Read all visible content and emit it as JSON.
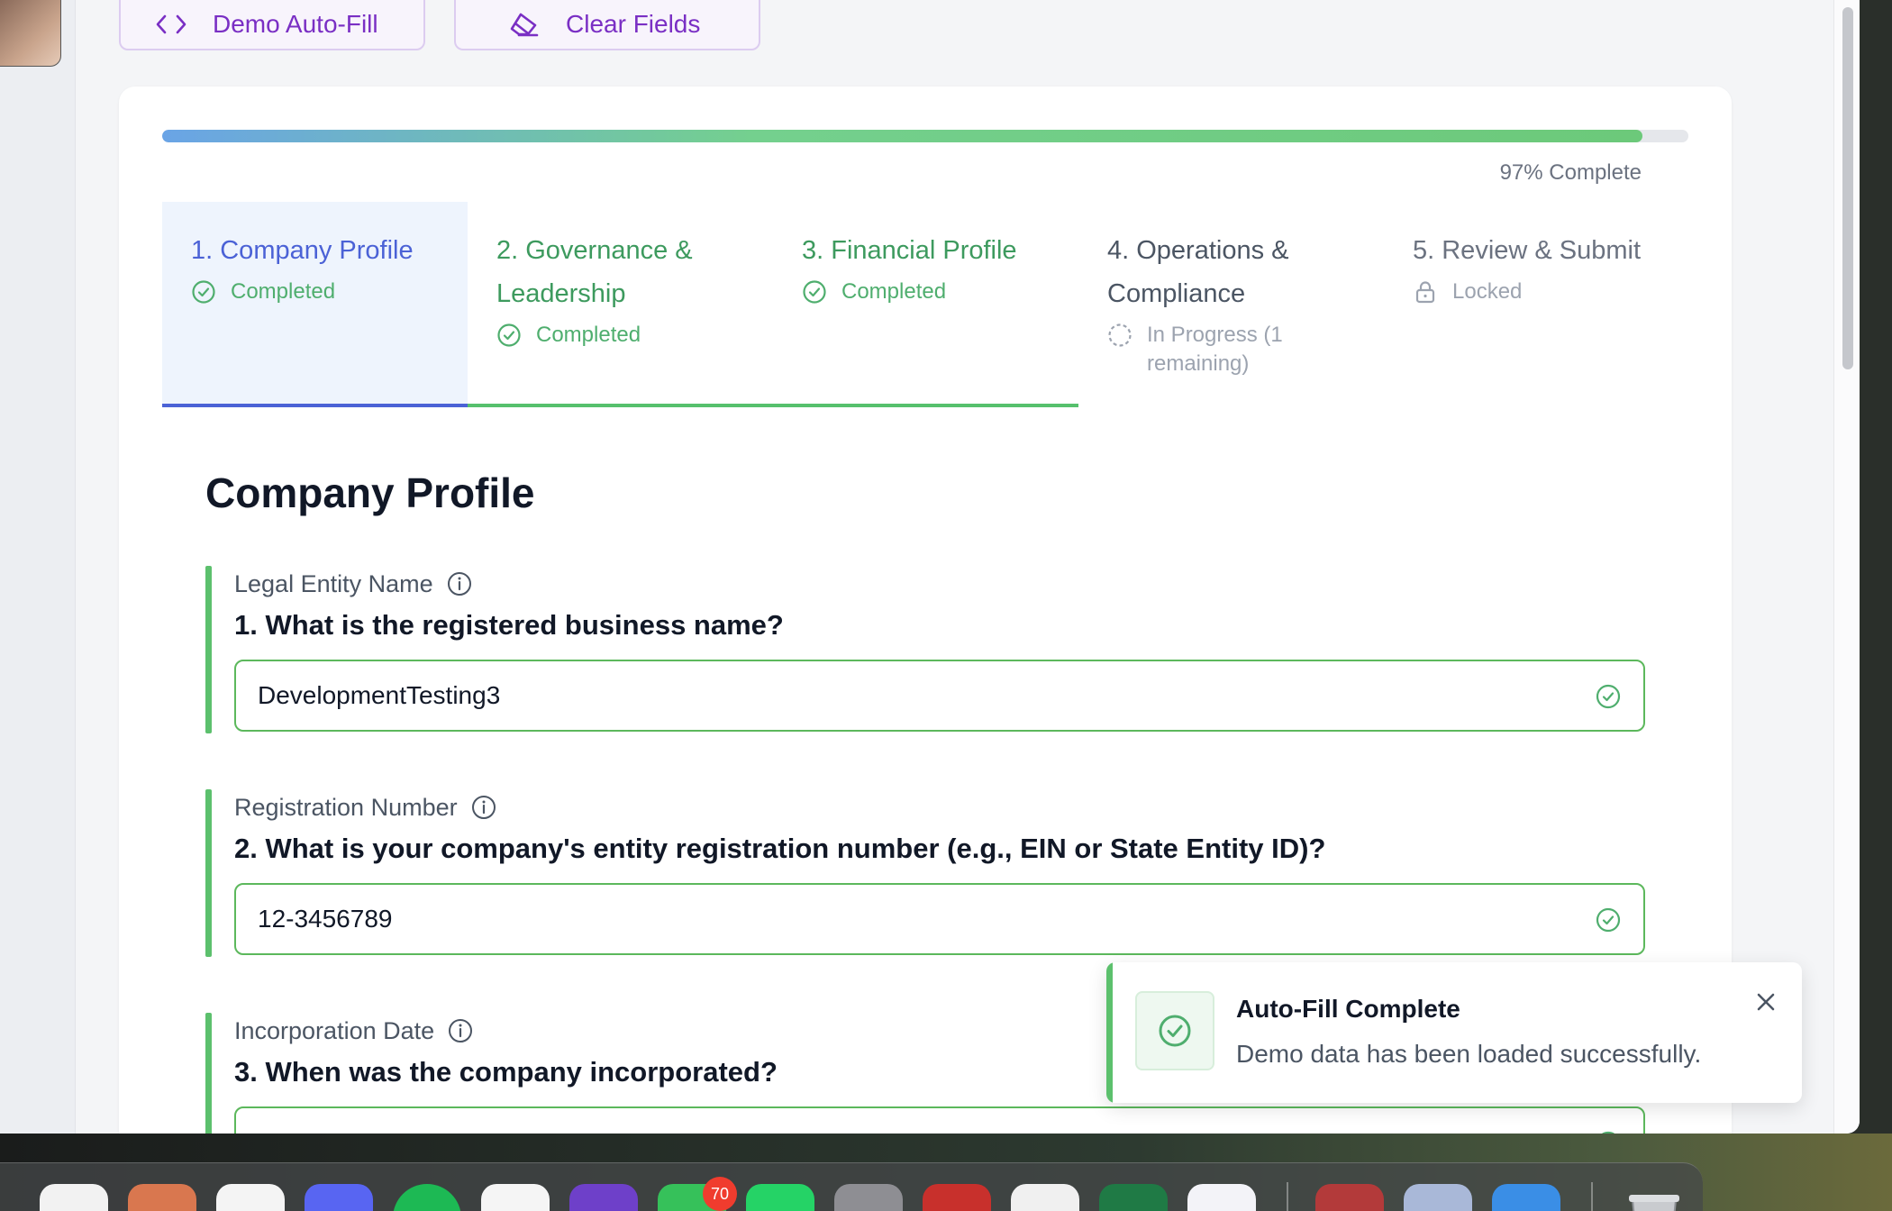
{
  "toolbar": {
    "autofill_label": "Demo Auto-Fill",
    "clear_label": "Clear Fields"
  },
  "progress": {
    "percent": 97,
    "text": "97% Complete"
  },
  "steps": [
    {
      "title": "1. Company Profile",
      "status": "Completed",
      "state": "completed",
      "active": true
    },
    {
      "title": "2. Governance & Leadership",
      "status": "Completed",
      "state": "completed",
      "active": false
    },
    {
      "title": "3. Financial Profile",
      "status": "Completed",
      "state": "completed",
      "active": false
    },
    {
      "title": "4. Operations & Compliance",
      "status": "In Progress (1 remaining)",
      "state": "in-progress",
      "active": false
    },
    {
      "title": "5. Review & Submit",
      "status": "Locked",
      "state": "locked",
      "active": false
    }
  ],
  "section": {
    "title": "Company Profile"
  },
  "fields": [
    {
      "label": "Legal Entity Name",
      "question": "1. What is the registered business name?",
      "value": "DevelopmentTesting3"
    },
    {
      "label": "Registration Number",
      "question": "2. What is your company's entity registration number (e.g., EIN or State Entity ID)?",
      "value": "12-3456789"
    },
    {
      "label": "Incorporation Date",
      "question": "3. When was the company incorporated?",
      "value": ""
    }
  ],
  "toast": {
    "title": "Auto-Fill Complete",
    "message": "Demo data has been loaded successfully."
  },
  "dock": {
    "messages_badge": "70"
  },
  "colors": {
    "accent_blue": "#4b62d6",
    "success_green": "#5cc06d",
    "purple": "#7a2fc4"
  }
}
